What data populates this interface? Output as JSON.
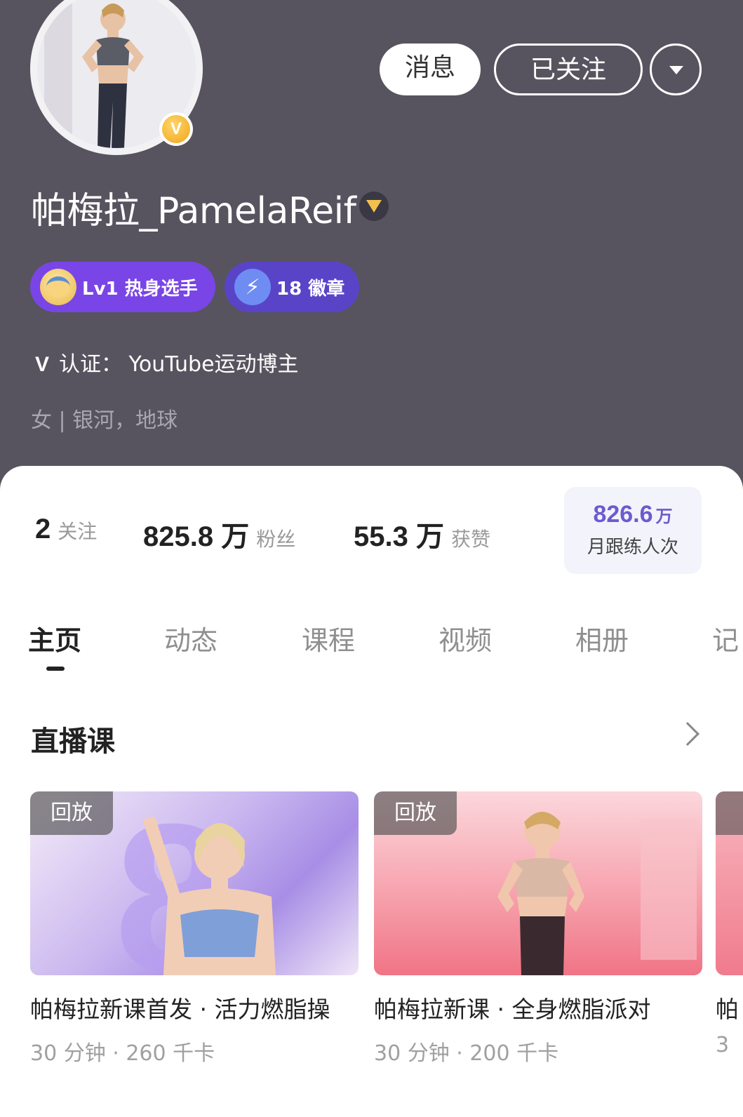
{
  "header": {
    "username": "帕梅拉_PamelaReif",
    "verified_badge_letter": "V",
    "message_button": "消息",
    "follow_button": "已关注",
    "level_pill": "Lv1 热身选手",
    "badges_pill": "18 徽章",
    "certification": "认证：  YouTube运动博主",
    "location": "女 | 银河，地球"
  },
  "stats": {
    "following_count": "2",
    "following_label": "关注",
    "followers_count": "825.8 万",
    "followers_label": "粉丝",
    "likes_count": "55.3 万",
    "likes_label": "获赞",
    "monthly_value": "826.6",
    "monthly_unit": "万",
    "monthly_label": "月跟练人次"
  },
  "tabs": [
    "主页",
    "动态",
    "课程",
    "视频",
    "相册",
    "记"
  ],
  "section": {
    "title": "直播课"
  },
  "cards": [
    {
      "tag": "回放",
      "title": "帕梅拉新课首发 · 活力燃脂操",
      "meta": "30 分钟 · 260 千卡"
    },
    {
      "tag": "回放",
      "title": "帕梅拉新课 · 全身燃脂派对",
      "meta": "30 分钟 · 200 千卡"
    }
  ],
  "peek_card": {
    "title": "帕",
    "meta": "3"
  },
  "colors": {
    "header_bg": "#57545f",
    "level_pill": "#7a45e6",
    "badge_pill": "#5944c8",
    "accent_purple": "#6b5ccf"
  }
}
